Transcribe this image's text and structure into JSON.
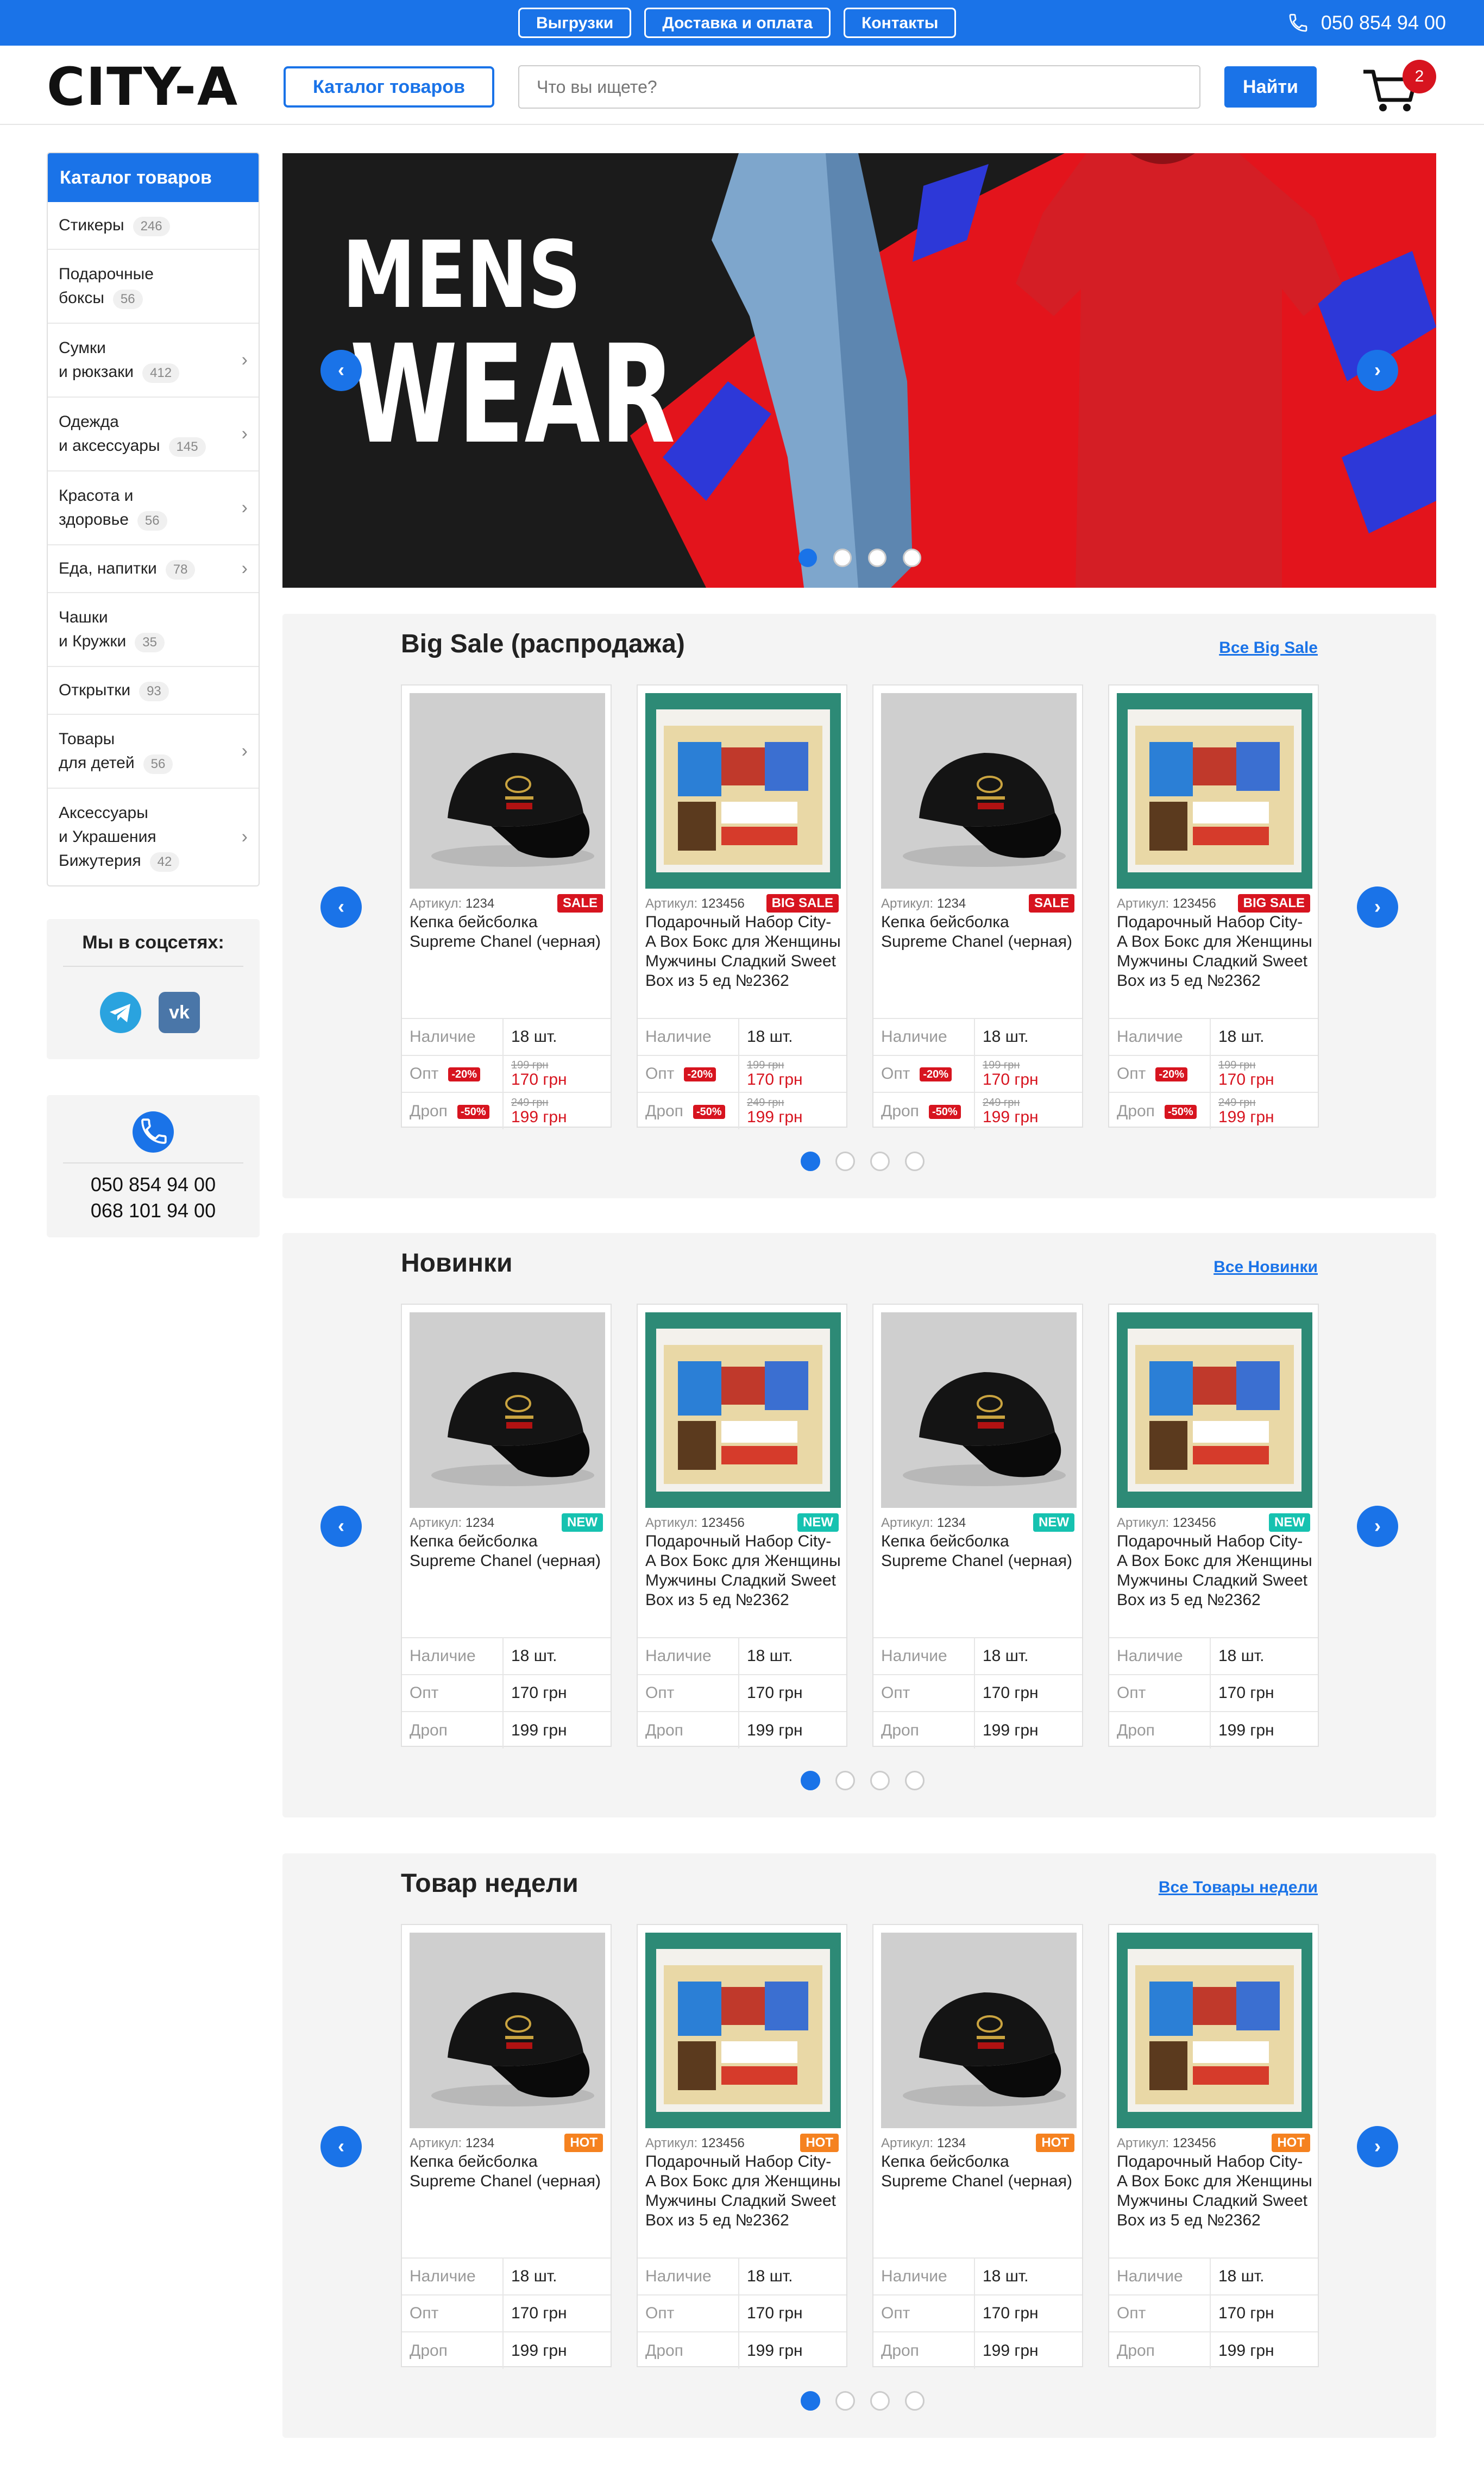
{
  "topbar": {
    "nav": [
      "Выгрузки",
      "Доставка и оплата",
      "Контакты"
    ],
    "phone": "050 854 94 00"
  },
  "header": {
    "logo": "CITY-A",
    "catalog_button": "Каталог товаров",
    "search_placeholder": "Что вы ищете?",
    "search_button": "Найти",
    "cart_count": "2"
  },
  "sidebar": {
    "title": "Каталог товаров",
    "items": [
      {
        "label": "Стикеры",
        "count": "246"
      },
      {
        "label": "Подарочные\nбоксы",
        "count": "56"
      },
      {
        "label": "Сумки\nи рюкзаки",
        "count": "412"
      },
      {
        "label": "Одежда\nи аксессуары",
        "count": "145"
      },
      {
        "label": "Красота и\nздоровье",
        "count": "56"
      },
      {
        "label": "Еда, напитки",
        "count": "78"
      },
      {
        "label": "Чашки\nи Кружки",
        "count": "35"
      },
      {
        "label": "Открытки",
        "count": "93"
      },
      {
        "label": "Товары\nдля детей",
        "count": "56"
      },
      {
        "label": "Аксессуары\nи Украшения\nБижутерия",
        "count": "42"
      }
    ]
  },
  "social": {
    "title": "Мы в соцсетях:"
  },
  "contacts": {
    "phone1": "050 854 94 00",
    "phone2": "068 101 94 00"
  },
  "banner": {
    "line1": "MENS",
    "line2": "WEAR"
  },
  "products": {
    "cap_article": "1234",
    "box_article": "123456",
    "article_label": "Артикул:",
    "cap_name": "Кепка бейсболка Supreme Chanel (черная)",
    "box_name": "Подарочный Набор City-A Box Бокс для Женщины Мужчины Сладкий Sweet Box из 5 ед №2362",
    "stock_label": "Наличие",
    "stock_value": "18 шт.",
    "opt_label": "Опт",
    "drop_label": "Дроп",
    "opt_price": "170 грн",
    "drop_price": "199 грн",
    "opt_pct": "-20%",
    "drop_pct": "-50%",
    "opt_old": "199 грн",
    "drop_old": "249 грн"
  },
  "sections": [
    {
      "title": "Big Sale (распродажа)",
      "link": "Все Big Sale",
      "tags": [
        "SALE",
        "BIG SALE",
        "SALE",
        "BIG SALE"
      ],
      "tag_color": "#d7141f",
      "discount": true
    },
    {
      "title": "Новинки",
      "link": "Все Новинки",
      "tags": [
        "NEW",
        "NEW",
        "NEW",
        "NEW"
      ],
      "tag_color": "#16c2b0",
      "discount": false
    },
    {
      "title": "Товар недели",
      "link": "Все Товары недели",
      "tags": [
        "HOT",
        "HOT",
        "HOT",
        "HOT"
      ],
      "tag_color": "#f58220",
      "discount": false
    }
  ],
  "colors": {
    "accent": "#1a73e8",
    "sale": "#d7141f",
    "new": "#16c2b0",
    "hot": "#f58220"
  }
}
